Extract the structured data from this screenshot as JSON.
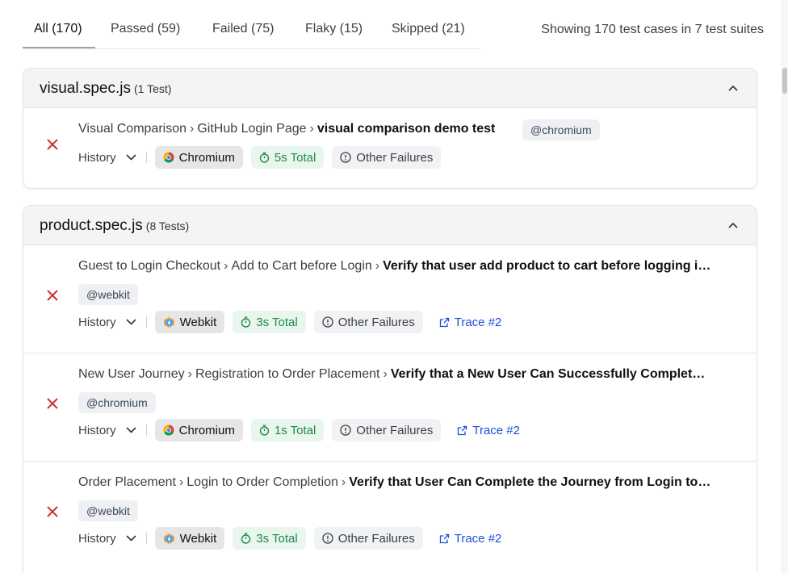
{
  "tabs": [
    {
      "label": "All (170)",
      "active": true
    },
    {
      "label": "Passed (59)"
    },
    {
      "label": "Failed (75)"
    },
    {
      "label": "Flaky (15)"
    },
    {
      "label": "Skipped (21)"
    }
  ],
  "summary": "Showing 170 test cases in 7 test suites",
  "colors": {
    "fail": "#d32f2f",
    "trace": "#1d4ed8",
    "time_green": "#1e8a4b"
  },
  "suites": [
    {
      "title": "visual.spec.js",
      "count": "(1 Test)",
      "tests": [
        {
          "path1": "Visual Comparison",
          "path2": "GitHub Login Page",
          "name": "visual comparison demo test",
          "tag": "@chromium",
          "history": "History",
          "browser": "Chromium",
          "browser_icon": "chromium-icon",
          "duration": "5s Total",
          "failures": "Other Failures"
        }
      ]
    },
    {
      "title": "product.spec.js",
      "count": "(8 Tests)",
      "tests": [
        {
          "path1": "Guest to Login Checkout",
          "path2": "Add to Cart before Login",
          "name": "Verify that user add product to cart before logging i…",
          "tag": "@webkit",
          "history": "History",
          "browser": "Webkit",
          "browser_icon": "webkit-icon",
          "duration": "3s Total",
          "failures": "Other Failures",
          "trace": "Trace #2"
        },
        {
          "path1": "New User Journey",
          "path2": "Registration to Order Placement",
          "name": "Verify that a New User Can Successfully Complet…",
          "tag": "@chromium",
          "history": "History",
          "browser": "Chromium",
          "browser_icon": "chromium-icon",
          "duration": "1s Total",
          "failures": "Other Failures",
          "trace": "Trace #2"
        },
        {
          "path1": "Order Placement",
          "path2": "Login to Order Completion",
          "name": "Verify that User Can Complete the Journey from Login to…",
          "tag": "@webkit",
          "history": "History",
          "browser": "Webkit",
          "browser_icon": "webkit-icon",
          "duration": "3s Total",
          "failures": "Other Failures",
          "trace": "Trace #2"
        }
      ]
    }
  ],
  "breadcrumb_separator": "›"
}
